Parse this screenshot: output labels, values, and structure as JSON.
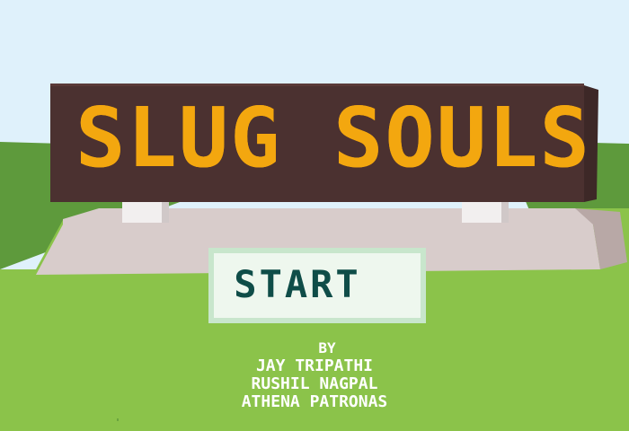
{
  "game": {
    "title": "SLUG SOULS",
    "start_label": "START",
    "credits": {
      "by": "BY",
      "authors": [
        "JAY TRIPATHI",
        "RUSHIL NAGPAL",
        "ATHENA PATRONAS"
      ]
    }
  },
  "colors": {
    "sky": "#dff1fb",
    "grass_light": "#8bc34a",
    "grass_dark": "#5e9a3c",
    "sign_board": "#4b3130",
    "title_text": "#f3a70f",
    "pedestal": "#d8cccb",
    "start_border": "#c8e6cc",
    "start_fill": "#eef7ee",
    "start_text": "#0f4d48",
    "credits_text": "#ffffff"
  }
}
